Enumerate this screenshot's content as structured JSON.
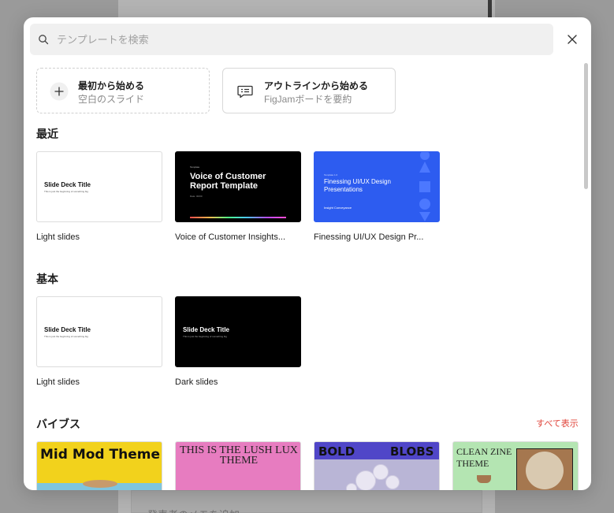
{
  "background": {
    "notes_placeholder": "発表者のメモを追加"
  },
  "modal": {
    "search": {
      "placeholder": "テンプレートを検索"
    },
    "start_options": [
      {
        "title": "最初から始める",
        "subtitle": "空白のスライド",
        "icon": "plus-icon"
      },
      {
        "title": "アウトラインから始める",
        "subtitle": "FigJamボードを要約",
        "icon": "outline-icon"
      }
    ],
    "sections": {
      "recent": {
        "title": "最近",
        "items": [
          {
            "label": "Light slides",
            "thumb": {
              "title": "Slide Deck Title",
              "subtitle": "This is just the beginning of something big"
            }
          },
          {
            "label": "Voice of Customer Insights...",
            "thumb": {
              "title": "Voice of Customer Report Template",
              "small": "Template",
              "meta": "Date: 00/00"
            }
          },
          {
            "label": "Finessing UI/UX Design Pr...",
            "thumb": {
              "title": "Finessing UI/UX Design Presentations",
              "small": "Template 1.0",
              "meta": "Insight Conveyance"
            }
          }
        ]
      },
      "basic": {
        "title": "基本",
        "items": [
          {
            "label": "Light slides",
            "thumb": {
              "title": "Slide Deck Title",
              "subtitle": "This is just the beginning of something big"
            }
          },
          {
            "label": "Dark slides",
            "thumb": {
              "title": "Slide Deck Title",
              "subtitle": "This is just the beginning of something big"
            }
          }
        ]
      },
      "vibes": {
        "title": "バイブス",
        "see_all": "すべて表示",
        "items": [
          {
            "thumb_text": "Mid Mod Theme"
          },
          {
            "thumb_text": "THIS IS THE LUSH LUX THEME"
          },
          {
            "thumb_left": "BOLD",
            "thumb_right": "BLOBS"
          },
          {
            "thumb_text": "CLEAN ZINE THEME"
          }
        ]
      }
    }
  },
  "colors": {
    "accent_link": "#e0443a",
    "blue_thumb": "#2d5cf0"
  }
}
